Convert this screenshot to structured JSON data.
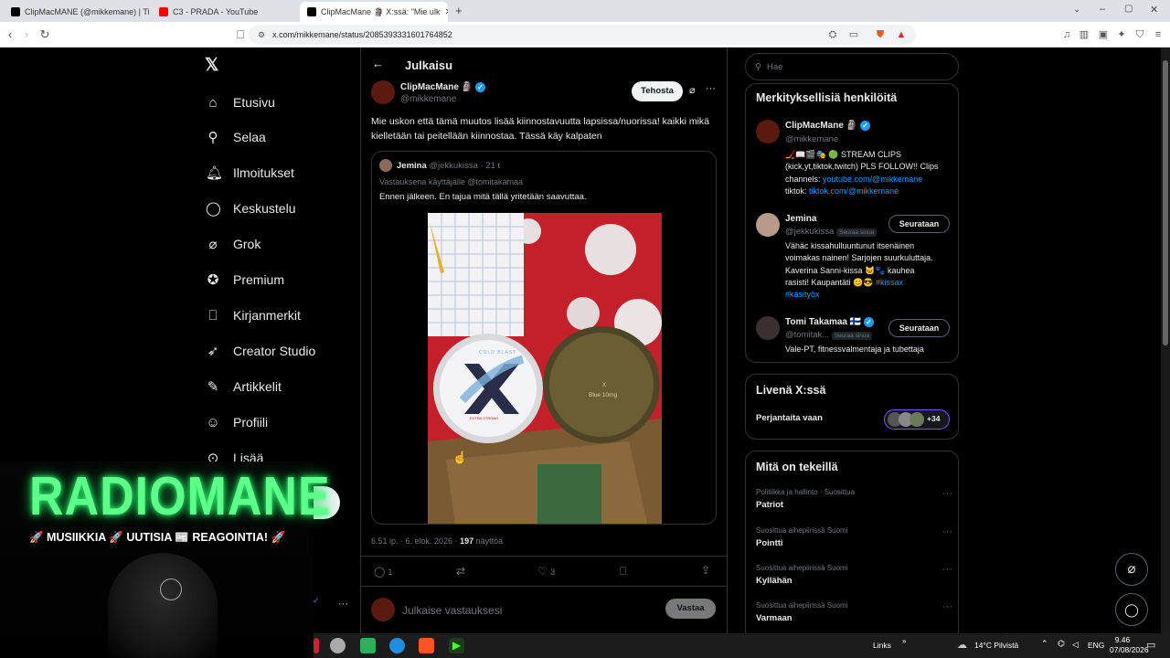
{
  "browser": {
    "tabs": [
      {
        "title": "ClipMacMANE (@mikkemane) | TikT..."
      },
      {
        "title": "C3 - PRADA - YouTube"
      },
      {
        "title": "ClipMacMane 🗿 X:ssä: \"Mie ulk"
      }
    ],
    "url": "x.com/mikkemane/status/2085393331601764852"
  },
  "sidebar": {
    "items": [
      {
        "label": "Etusivu",
        "icon": "home-icon"
      },
      {
        "label": "Selaa",
        "icon": "search-icon"
      },
      {
        "label": "Ilmoitukset",
        "icon": "bell-icon"
      },
      {
        "label": "Keskustelu",
        "icon": "chat-icon"
      },
      {
        "label": "Grok",
        "icon": "grok-icon"
      },
      {
        "label": "Premium",
        "icon": "premium-icon"
      },
      {
        "label": "Kirjanmerkit",
        "icon": "bookmark-icon"
      },
      {
        "label": "Creator Studio",
        "icon": "rocket-icon"
      },
      {
        "label": "Artikkelit",
        "icon": "article-icon"
      },
      {
        "label": "Profiili",
        "icon": "user-icon"
      },
      {
        "label": "Lisää",
        "icon": "more-icon"
      }
    ]
  },
  "post": {
    "header_title": "Julkaisu",
    "author_name": "ClipMacMane 🗿",
    "author_handle": "@mikkemane",
    "boost_label": "Tehosta",
    "text": "Mie uskon että tämä muutos lisää kiinnostavuutta lapsissa/nuorissa! kaikki mikä kielletään tai peitellään kiinnostaa. Tässä käy kalpaten",
    "quote": {
      "author_name": "Jemina",
      "author_handle": "@jekkukissa",
      "time": "· 21 t",
      "reply_to": "Vastauksena käyttäjälle @tomitakamaa",
      "text": "Ennen jälkeen. En tajua mitä tällä yritetään saavuttaa.",
      "image_text": {
        "left_lid": "COLD BLAST",
        "left_sub": "EXTRA STRONG",
        "right_lid": "X",
        "right_sub": "Blue 10mg"
      }
    },
    "meta_time": "6.51 ip. · 6. elok. 2026 ·",
    "views_count": "197",
    "views_label": "näyttöä",
    "replies": "1",
    "likes": "3",
    "reply_placeholder": "Julkaise vastauksesi",
    "reply_button": "Vastaa"
  },
  "right": {
    "search_placeholder": "Hae",
    "relevant_title": "Merkityksellisiä henkilöitä",
    "people": [
      {
        "name": "ClipMacMane 🗿",
        "handle": "@mikkemane",
        "bio_lines": [
          "🏒📖🎬🎭 🟢 STREAM CLIPS",
          "(kick,yt,tiktok,twitch) PLS FOLLOW!! Clips",
          "channels: "
        ],
        "bio_link1": "youtube.com/@mikkemane",
        "bio_prefix2": "tiktok: ",
        "bio_link2": "tiktok.com/@mikkemane"
      },
      {
        "name": "Jemina",
        "handle": "@jekkukissa",
        "follows_you": "Seuraa sinua",
        "follow_label": "Seurataan",
        "bio_lines": [
          "Vähäc kissahulluuntunut itsenäinen",
          "voimakas nainen! Sarjojen suurkuluttaja.",
          "Kaverina Sanni-kissa 🐱🐾 kauhea",
          "rasisti! Kaupantäti 😊😎 "
        ],
        "hashtag1": "#kissax",
        "hashtag2": "#käsityöx"
      },
      {
        "name": "Tomi Takamaa 🇫🇮",
        "handle": "@tomitak...",
        "follows_you": "Seuraa sinua",
        "follow_label": "Seurataan",
        "bio_lines": [
          "Vale-PT, fitnessvalmentaja ja tubettaja"
        ]
      }
    ],
    "live_title": "Livenä X:ssä",
    "live_item": "Perjantaita vaan",
    "live_count": "+34",
    "trends_title": "Mitä on tekeillä",
    "trends": [
      {
        "context": "Politiikka ja hallinto · Suosittua",
        "name": "Patriot"
      },
      {
        "context": "Suosittua aihepiirissä Suomi",
        "name": "Pointti"
      },
      {
        "context": "Suosittua aihepiirissä Suomi",
        "name": "Kyllähän"
      },
      {
        "context": "Suosittua aihepiirissä Suomi",
        "name": "Varmaan"
      }
    ]
  },
  "overlay": {
    "logo_text": "RADIOMANE",
    "tagline": "🚀 MUSIIKKIA 🚀 UUTISIA 📰 REAGOINTIA! 🚀"
  },
  "taskbar": {
    "links": "Links",
    "weather": "14°C  Pilvistä",
    "lang": "ENG",
    "time": "9.46",
    "date": "07/08/2026"
  },
  "colors": {
    "accent": "#1d9bf0",
    "neon": "#5dff8a",
    "bg": "#000000"
  }
}
